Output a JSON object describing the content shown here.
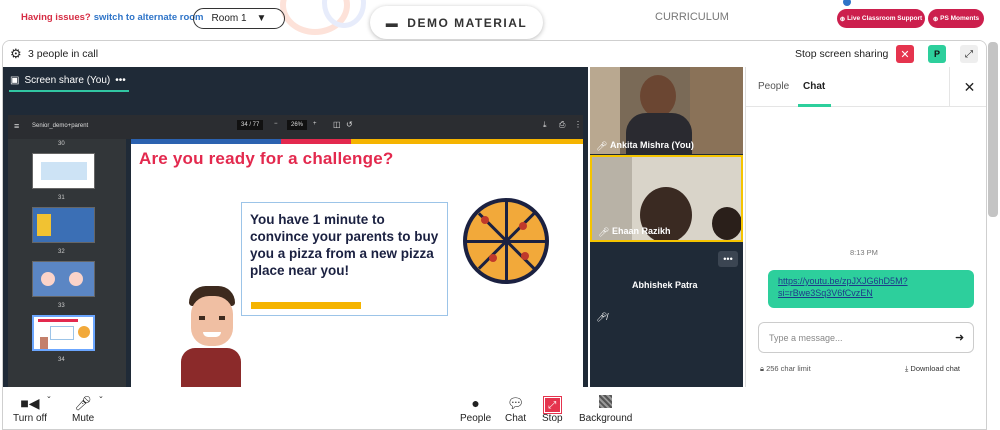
{
  "header": {
    "issue_text": "Having issues?",
    "switch_link": "switch to alternate room",
    "room_select": "Room 1",
    "demo_button": "DEMO MATERIAL",
    "curriculum_tab": "CURRICULUM",
    "live_support": "Live Classroom Support",
    "ps_moments": "PS Moments"
  },
  "callbar": {
    "people_count": "3 people in call",
    "stop_sharing": "Stop screen sharing",
    "participant_initial": "P"
  },
  "share": {
    "tab_label": "Screen share (You)",
    "pdf_name": "Senior_demo+parent",
    "page": "34 / 77",
    "zoom": "26%",
    "thumb_numbers": [
      "30",
      "31",
      "32",
      "33",
      "34"
    ],
    "slide_title": "Are you ready for a challenge?",
    "slide_body": "You have 1 minute to convince your parents to buy you a pizza from a new pizza place near you!"
  },
  "participants": [
    {
      "name": "Ankita Mishra (You)"
    },
    {
      "name": "Ehaan Razikh"
    },
    {
      "name": "Abhishek Patra"
    }
  ],
  "chat": {
    "tab_people": "People",
    "tab_chat": "Chat",
    "timestamp": "8:13 PM",
    "message": "https://youtu.be/zpJXJG6hD5M?si=rBwe3Sq3V6fCvzEN",
    "placeholder": "Type a message...",
    "char_limit": "256 char limit",
    "download": "Download chat"
  },
  "controls": {
    "video": "Turn off",
    "mute": "Mute",
    "people": "People",
    "chat": "Chat",
    "stop": "Stop",
    "background": "Background"
  },
  "colors": {
    "accent": "#2dcf9c",
    "danger": "#e5344e",
    "brand": "#cc1f4d"
  }
}
